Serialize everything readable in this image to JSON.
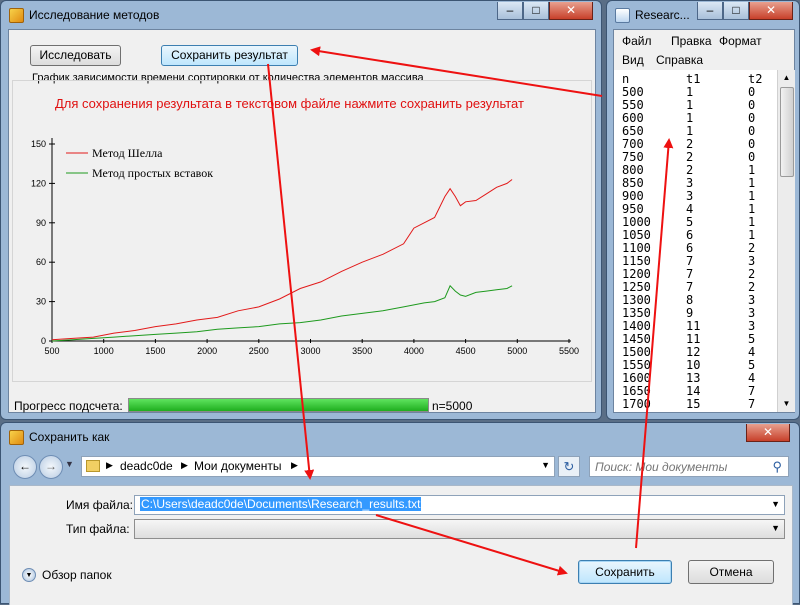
{
  "main_window": {
    "title": "Исследование методов",
    "buttons": {
      "research": "Исследовать",
      "save_result": "Сохранить результат"
    },
    "group_title": "График зависимости времени сортировки от количества элементов массива",
    "hint": "Для сохранения результата в текстовом файле нажмите сохранить результат",
    "progress_label": "Прогресс подсчета:",
    "progress_value": 1.0,
    "progress_text": "n=5000"
  },
  "chart_data": {
    "type": "line",
    "xlim": [
      500,
      5500
    ],
    "ylim": [
      0,
      150
    ],
    "xticks": [
      "500",
      "1000",
      "1500",
      "2000",
      "2500",
      "3000",
      "3500",
      "4000",
      "4500",
      "5000",
      "5500"
    ],
    "yticks": [
      "0",
      "30",
      "60",
      "90",
      "120",
      "150"
    ],
    "legend_position": "top-left",
    "series": [
      {
        "name": "Метод Шелла",
        "color": "#e21a1a",
        "x": [
          500,
          700,
          900,
          1100,
          1300,
          1500,
          1700,
          1900,
          2100,
          2300,
          2500,
          2700,
          2900,
          3100,
          3300,
          3500,
          3700,
          3900,
          4000,
          4100,
          4200,
          4300,
          4350,
          4400,
          4450,
          4500,
          4600,
          4700,
          4800,
          4900,
          4950
        ],
        "y": [
          1,
          2,
          3,
          6,
          8,
          11,
          13,
          16,
          18,
          23,
          26,
          32,
          40,
          45,
          53,
          60,
          66,
          74,
          86,
          90,
          94,
          110,
          116,
          110,
          103,
          106,
          107,
          112,
          117,
          120,
          123
        ]
      },
      {
        "name": "Метод простых вставок",
        "color": "#1e9a1e",
        "x": [
          500,
          700,
          900,
          1100,
          1300,
          1500,
          1700,
          1900,
          2100,
          2300,
          2500,
          2700,
          2900,
          3100,
          3300,
          3500,
          3700,
          3900,
          4100,
          4200,
          4300,
          4350,
          4400,
          4450,
          4500,
          4600,
          4700,
          4800,
          4900,
          4950
        ],
        "y": [
          0,
          1,
          2,
          3,
          4,
          5,
          6,
          7,
          9,
          10,
          11,
          13,
          14,
          16,
          19,
          21,
          23,
          26,
          29,
          30,
          33,
          42,
          38,
          35,
          34,
          37,
          38,
          39,
          40,
          42
        ]
      }
    ]
  },
  "notepad": {
    "title": "Researc...",
    "menu": [
      "Файл",
      "Правка",
      "Формат",
      "Вид",
      "Справка"
    ],
    "headers": [
      "n",
      "t1",
      "t2"
    ],
    "rows": [
      [
        "500",
        "1",
        "0"
      ],
      [
        "550",
        "1",
        "0"
      ],
      [
        "600",
        "1",
        "0"
      ],
      [
        "650",
        "1",
        "0"
      ],
      [
        "700",
        "2",
        "0"
      ],
      [
        "750",
        "2",
        "0"
      ],
      [
        "800",
        "2",
        "1"
      ],
      [
        "850",
        "3",
        "1"
      ],
      [
        "900",
        "3",
        "1"
      ],
      [
        "950",
        "4",
        "1"
      ],
      [
        "1000",
        "5",
        "1"
      ],
      [
        "1050",
        "6",
        "1"
      ],
      [
        "1100",
        "6",
        "2"
      ],
      [
        "1150",
        "7",
        "3"
      ],
      [
        "1200",
        "7",
        "2"
      ],
      [
        "1250",
        "7",
        "2"
      ],
      [
        "1300",
        "8",
        "3"
      ],
      [
        "1350",
        "9",
        "3"
      ],
      [
        "1400",
        "11",
        "3"
      ],
      [
        "1450",
        "11",
        "5"
      ],
      [
        "1500",
        "12",
        "4"
      ],
      [
        "1550",
        "10",
        "5"
      ],
      [
        "1600",
        "13",
        "4"
      ],
      [
        "1650",
        "14",
        "7"
      ],
      [
        "1700",
        "15",
        "7"
      ]
    ]
  },
  "save_dialog": {
    "title": "Сохранить как",
    "breadcrumb": [
      "deadc0de",
      "Мои документы"
    ],
    "search_placeholder": "Поиск: Мои документы",
    "filename_label": "Имя файла:",
    "filename_value": "C:\\Users\\deadc0de\\Documents\\Research_results.txt",
    "filetype_label": "Тип файла:",
    "filetype_value": "",
    "browse_folders": "Обзор папок",
    "save_button": "Сохранить",
    "cancel_button": "Отмена"
  },
  "colors": {
    "accent_red": "#ee1111",
    "progress_green": "#28c228",
    "window_frame": "#9cb8d6"
  }
}
